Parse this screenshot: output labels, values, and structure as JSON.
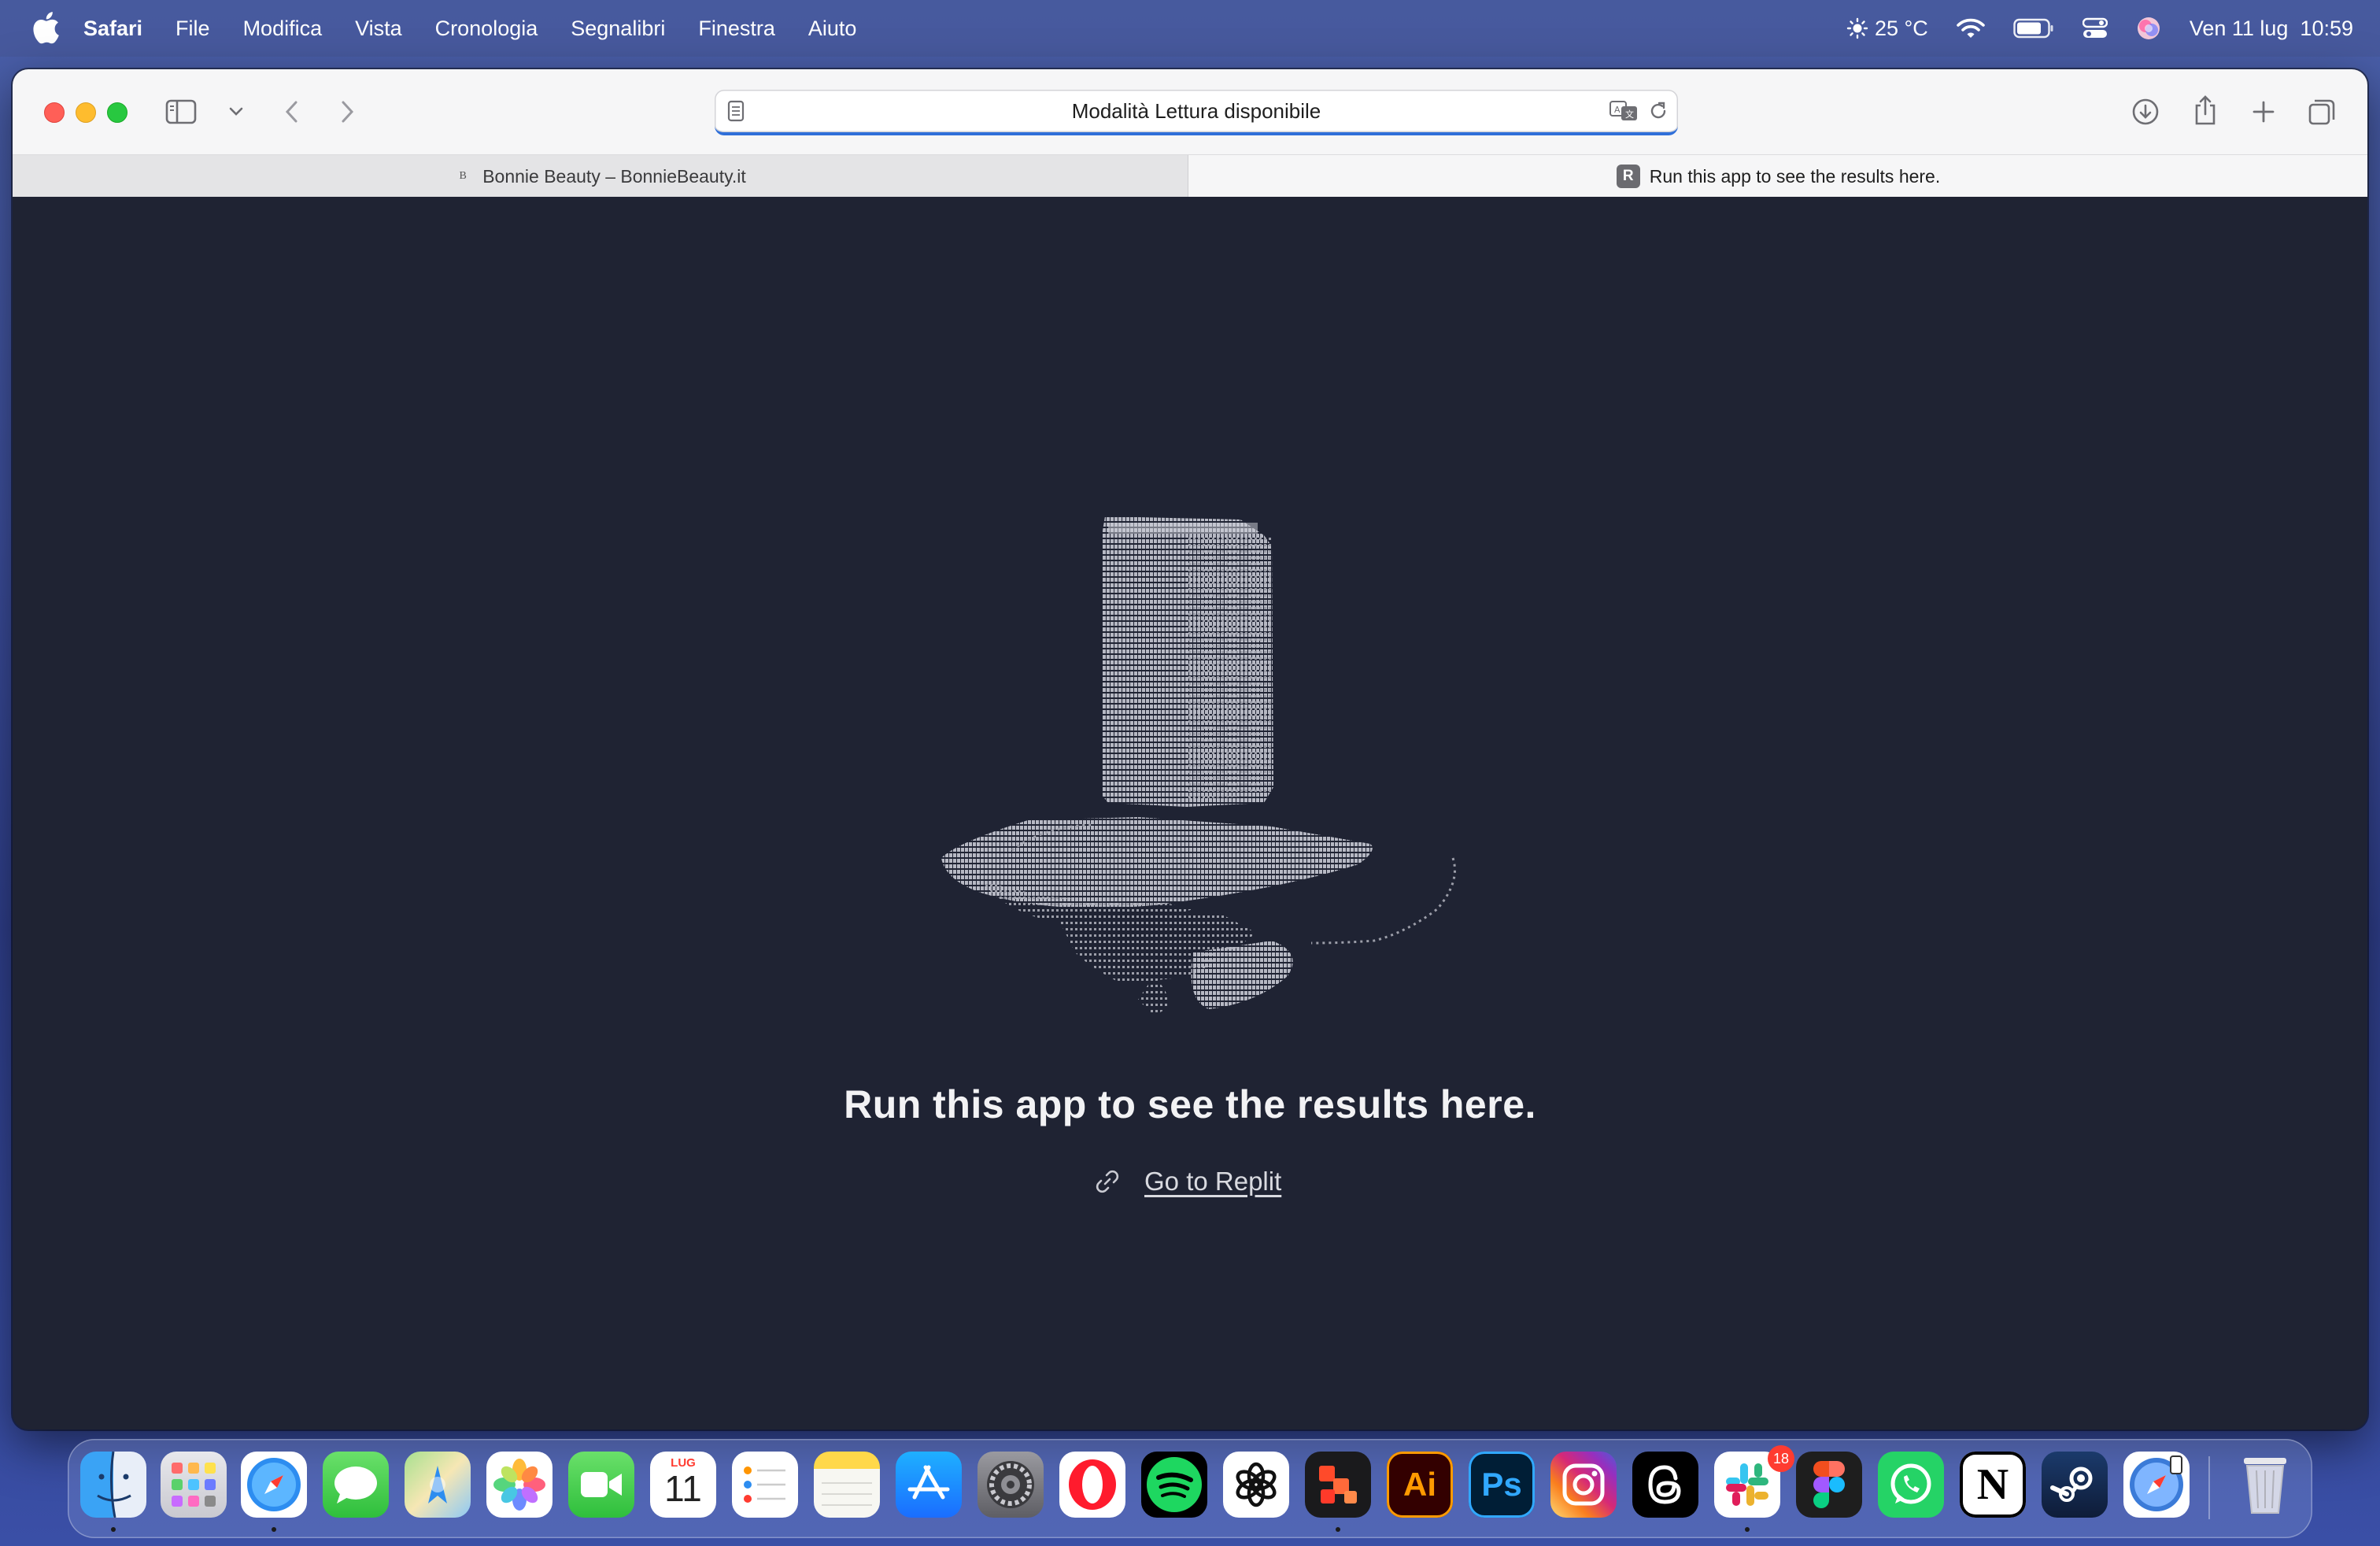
{
  "menubar": {
    "app_name": "Safari",
    "items": [
      "File",
      "Modifica",
      "Vista",
      "Cronologia",
      "Segnalibri",
      "Finestra",
      "Aiuto"
    ],
    "weather": "25 °C",
    "datetime": "Ven 11 lug  10:59"
  },
  "toolbar": {
    "address_text": "Modalità Lettura disponibile"
  },
  "tabs": [
    {
      "favicon": "B",
      "title": "Bonnie Beauty – BonnieBeauty.it",
      "active": false
    },
    {
      "favicon": "R",
      "title": "Run this app to see the results here.",
      "active": true
    }
  ],
  "content": {
    "message": "Run this app to see the results here.",
    "link_text": "Go to Replit"
  },
  "dock": {
    "calendar_month": "LUG",
    "calendar_day": "11",
    "slack_badge": "18",
    "apps": [
      "finder",
      "launchpad",
      "safari",
      "messages",
      "maps",
      "photos",
      "facetime",
      "calendar",
      "reminders",
      "notes",
      "app-store",
      "system-settings",
      "opera",
      "spotify",
      "chatgpt",
      "taskade",
      "illustrator",
      "photoshop",
      "instagram",
      "threads",
      "slack",
      "figma",
      "whatsapp",
      "notion",
      "steam",
      "safari-tech-preview",
      "trash"
    ]
  },
  "colors": {
    "content_bg": "#1f2333",
    "address_focus": "#2f6fd9"
  }
}
